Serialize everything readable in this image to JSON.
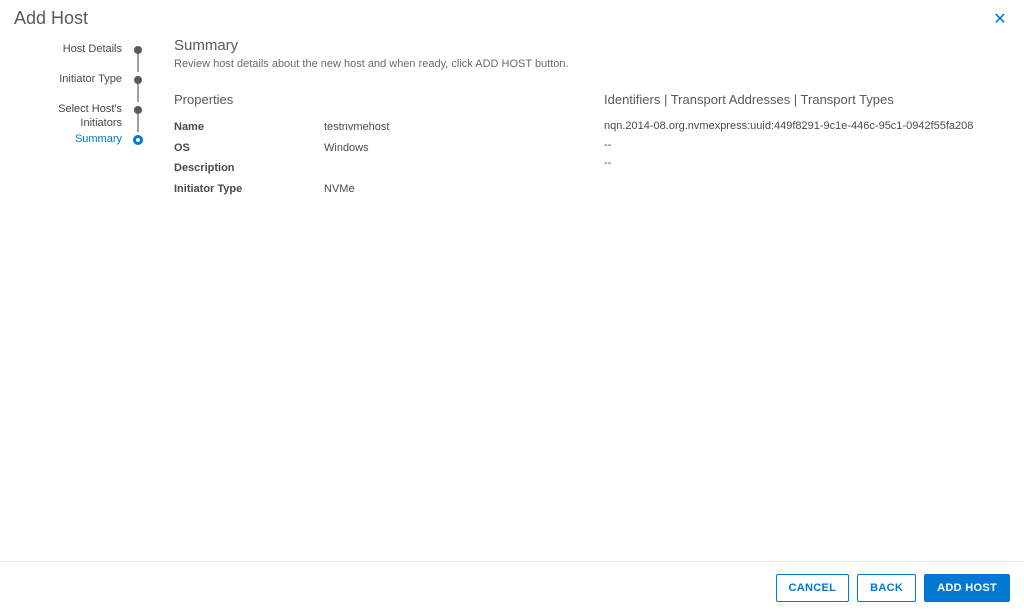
{
  "header": {
    "title": "Add Host",
    "close_label": "✕"
  },
  "wizard": {
    "steps": [
      {
        "label": "Host Details"
      },
      {
        "label": "Initiator Type"
      },
      {
        "label": "Select Host's Initiators"
      },
      {
        "label": "Summary"
      }
    ],
    "active_index": 3
  },
  "summary": {
    "heading": "Summary",
    "hint": "Review host details about the new host and when ready, click ADD HOST button.",
    "properties_heading": "Properties",
    "properties": {
      "name_label": "Name",
      "name_value": "testnvmehost",
      "os_label": "OS",
      "os_value": "Windows",
      "description_label": "Description",
      "description_value": "",
      "initiator_type_label": "Initiator Type",
      "initiator_type_value": "NVMe"
    },
    "identifiers_heading": "Identifiers | Transport Addresses | Transport Types",
    "identifiers": {
      "row0": "nqn.2014-08.org.nvmexpress:uuid:449f8291-9c1e-446c-95c1-0942f55fa208",
      "row1": "--",
      "row2": "--"
    }
  },
  "footer": {
    "cancel": "CANCEL",
    "back": "BACK",
    "add_host": "ADD HOST"
  }
}
